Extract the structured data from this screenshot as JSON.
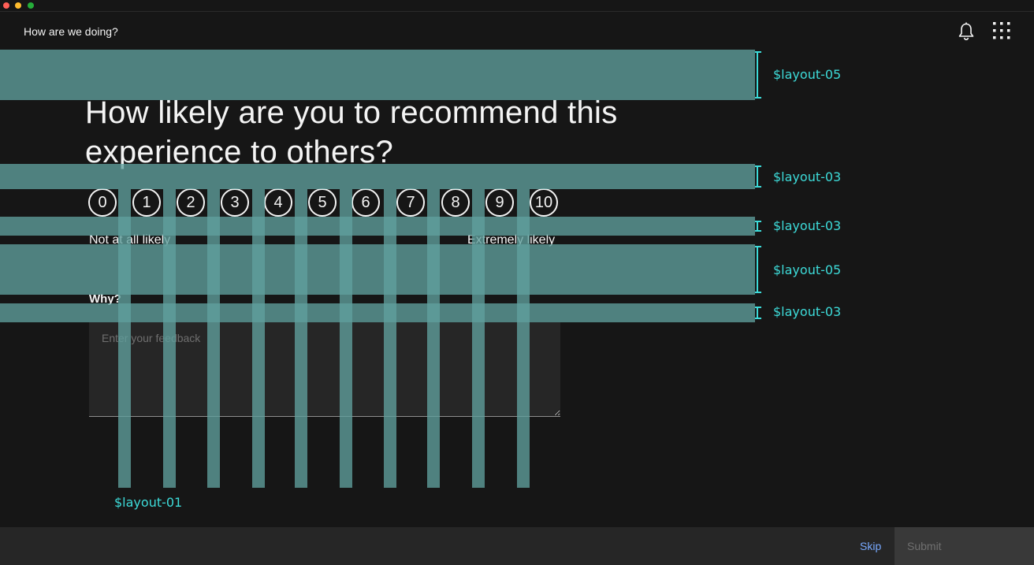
{
  "header": {
    "title": "How are we doing?",
    "notification_icon": "bell-icon",
    "switcher_icon": "app-switcher-grid-icon"
  },
  "survey": {
    "question": "How likely are you to recommend this experience to others?",
    "ratings": [
      "0",
      "1",
      "2",
      "3",
      "4",
      "5",
      "6",
      "7",
      "8",
      "9",
      "10"
    ],
    "scale_low_label": "Not at all likely",
    "scale_high_label": "Extremely likely",
    "why_label": "Why?",
    "feedback_placeholder": "Enter your feedback",
    "feedback_value": ""
  },
  "spacing_annotations": {
    "band_1": "$layout-05",
    "band_2": "$layout-03",
    "band_3": "$layout-03",
    "band_4": "$layout-05",
    "band_5": "$layout-03",
    "columns": "$layout-01"
  },
  "footer": {
    "skip_label": "Skip",
    "submit_label": "Submit"
  },
  "colors": {
    "background": "#161616",
    "annotation_overlay": "#60a09e",
    "annotation_text": "#3ddbd9",
    "link": "#78a9ff",
    "footer_bg": "#262626",
    "submit_disabled_bg": "#393939"
  }
}
